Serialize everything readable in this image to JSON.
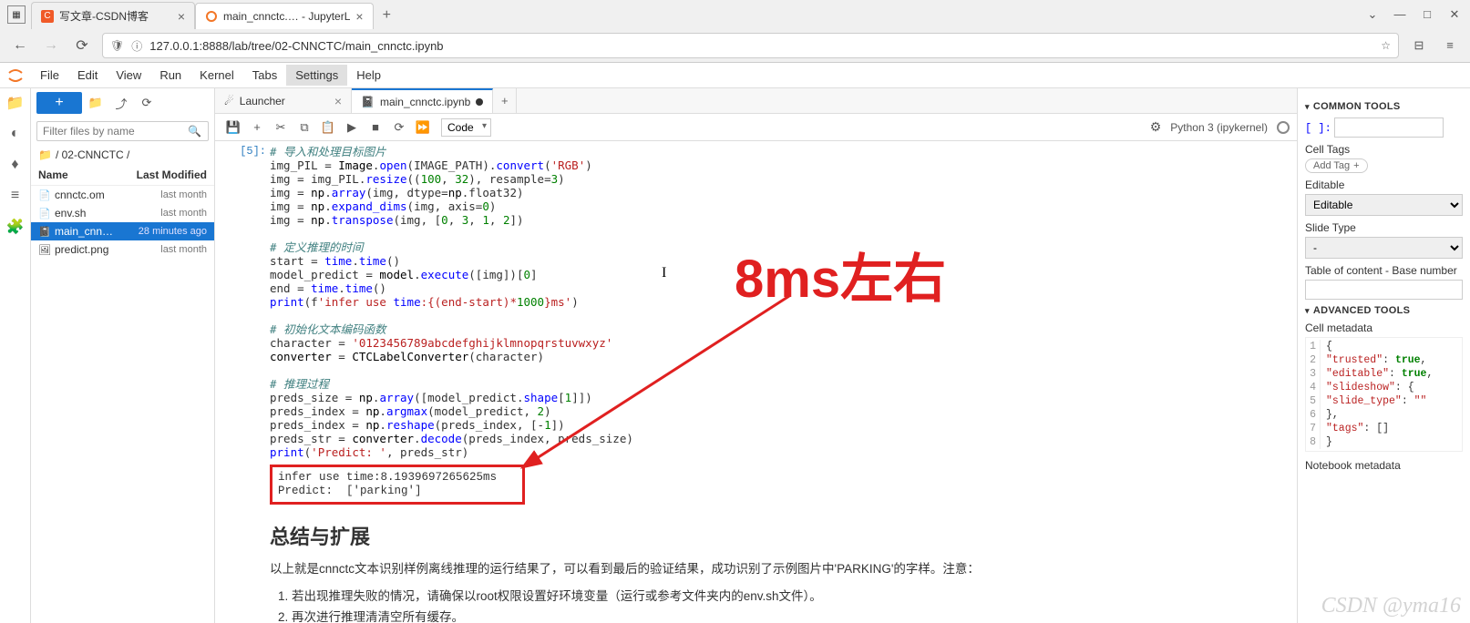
{
  "browser": {
    "tabs": [
      {
        "title": "写文章-CSDN博客",
        "favicon": "C",
        "active": false
      },
      {
        "title": "main_cnnctc.… - JupyterL",
        "favicon": "jup",
        "active": true
      }
    ],
    "url": "127.0.0.1:8888/lab/tree/02-CNNCTC/main_cnnctc.ipynb",
    "window_controls": {
      "min": "—",
      "max": "□",
      "close": "✕",
      "dropdown": "⌄"
    }
  },
  "menubar": [
    "File",
    "Edit",
    "View",
    "Run",
    "Kernel",
    "Tabs",
    "Settings",
    "Help"
  ],
  "menubar_active": "Settings",
  "file_browser": {
    "filter_placeholder": "Filter files by name",
    "breadcrumb": "/ 02-CNNCTC /",
    "header": {
      "name": "Name",
      "modified": "Last Modified"
    },
    "items": [
      {
        "icon": "📄",
        "name": "cnnctc.om",
        "modified": "last month",
        "selected": false
      },
      {
        "icon": "📄",
        "name": "env.sh",
        "modified": "last month",
        "selected": false
      },
      {
        "icon": "📓",
        "name": "main_cnn…",
        "modified": "28 minutes ago",
        "selected": true
      },
      {
        "icon": "🖼",
        "name": "predict.png",
        "modified": "last month",
        "selected": false
      }
    ]
  },
  "doc_tabs": [
    {
      "title": "Launcher",
      "icon": "☄",
      "active": false,
      "dirty": false
    },
    {
      "title": "main_cnnctc.ipynb",
      "icon": "📓",
      "active": true,
      "dirty": true
    }
  ],
  "nb_toolbar": {
    "cell_type": "Code",
    "kernel": "Python 3 (ipykernel)"
  },
  "cell": {
    "prompt": "[5]:",
    "lines": [
      {
        "t": "cmt",
        "s": "# 导入和处理目标图片"
      },
      {
        "t": "code",
        "s": "img_PIL = Image.open(IMAGE_PATH).convert('RGB')"
      },
      {
        "t": "code",
        "s": "img = img_PIL.resize((100, 32), resample=3)"
      },
      {
        "t": "code",
        "s": "img = np.array(img, dtype=np.float32)"
      },
      {
        "t": "code",
        "s": "img = np.expand_dims(img, axis=0)"
      },
      {
        "t": "code",
        "s": "img = np.transpose(img, [0, 3, 1, 2])"
      },
      {
        "t": "blank",
        "s": ""
      },
      {
        "t": "cmt",
        "s": "# 定义推理的时间"
      },
      {
        "t": "code",
        "s": "start = time.time()"
      },
      {
        "t": "code",
        "s": "model_predict = model.execute([img])[0]"
      },
      {
        "t": "code",
        "s": "end = time.time()"
      },
      {
        "t": "code",
        "s": "print(f'infer use time:{(end-start)*1000}ms')"
      },
      {
        "t": "blank",
        "s": ""
      },
      {
        "t": "cmt",
        "s": "# 初始化文本编码函数"
      },
      {
        "t": "code",
        "s": "character = '0123456789abcdefghijklmnopqrstuvwxyz'"
      },
      {
        "t": "code",
        "s": "converter = CTCLabelConverter(character)"
      },
      {
        "t": "blank",
        "s": ""
      },
      {
        "t": "cmt",
        "s": "# 推理过程"
      },
      {
        "t": "code",
        "s": "preds_size = np.array([model_predict.shape[1]])"
      },
      {
        "t": "code",
        "s": "preds_index = np.argmax(model_predict, 2)"
      },
      {
        "t": "code",
        "s": "preds_index = np.reshape(preds_index, [-1])"
      },
      {
        "t": "code",
        "s": "preds_str = converter.decode(preds_index, preds_size)"
      },
      {
        "t": "code",
        "s": "print('Predict: ', preds_str)"
      }
    ],
    "output": "infer use time:8.1939697265625ms\nPredict:  ['parking']"
  },
  "markdown": {
    "heading": "总结与扩展",
    "para": "以上就是cnnctc文本识别样例离线推理的运行结果了，可以看到最后的验证结果，成功识别了示例图片中'PARKING'的字样。注意：",
    "list": [
      "若出现推理失败的情况，请确保以root权限设置好环境变量（运行或参考文件夹内的env.sh文件）。",
      "再次进行推理清清空所有缓存。"
    ]
  },
  "right_sidebar": {
    "common_tools": "COMMON TOOLS",
    "brackets": "[ ]:",
    "cell_tags_label": "Cell Tags",
    "add_tag": "Add Tag",
    "editable_label": "Editable",
    "editable_value": "Editable",
    "slide_label": "Slide Type",
    "slide_value": "-",
    "toc_label": "Table of content - Base number",
    "advanced_tools": "ADVANCED TOOLS",
    "cell_meta_label": "Cell metadata",
    "cell_meta_json": [
      "{",
      "    \"trusted\": true,",
      "    \"editable\": true,",
      "    \"slideshow\": {",
      "        \"slide_type\": \"\"",
      "    },",
      "    \"tags\": []",
      "}"
    ],
    "notebook_meta_label": "Notebook metadata"
  },
  "annotation": {
    "text": "8ms左右"
  },
  "watermark": "CSDN @yma16"
}
